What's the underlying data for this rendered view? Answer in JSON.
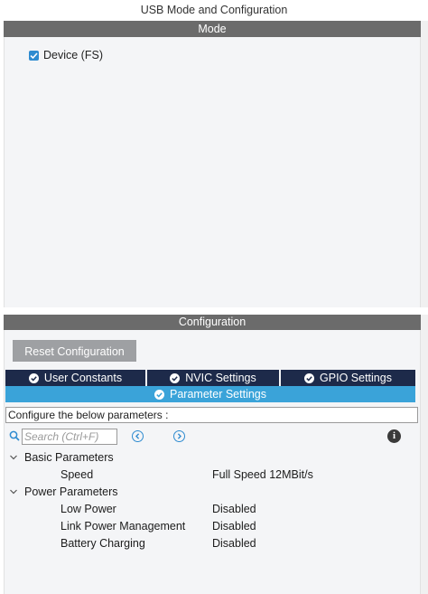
{
  "window": {
    "title": "USB Mode and Configuration"
  },
  "mode": {
    "header": "Mode",
    "device_fs": {
      "label": "Device (FS)",
      "checked": true
    }
  },
  "configuration": {
    "header": "Configuration",
    "reset_button": "Reset Configuration",
    "tabs": [
      {
        "label": "User Constants",
        "icon": "check-circle-icon"
      },
      {
        "label": "NVIC Settings",
        "icon": "check-circle-icon"
      },
      {
        "label": "GPIO Settings",
        "icon": "check-circle-icon"
      },
      {
        "label": "Parameter Settings",
        "icon": "check-circle-icon",
        "active": true
      }
    ],
    "hint": "Configure the below parameters :",
    "search": {
      "placeholder": "Search (Ctrl+F)",
      "value": ""
    },
    "groups": [
      {
        "name": "Basic Parameters",
        "params": [
          {
            "name": "Speed",
            "value": "Full Speed 12MBit/s"
          }
        ]
      },
      {
        "name": "Power Parameters",
        "params": [
          {
            "name": "Low Power",
            "value": "Disabled"
          },
          {
            "name": "Link Power Management",
            "value": "Disabled"
          },
          {
            "name": "Battery Charging",
            "value": "Disabled"
          }
        ]
      }
    ]
  },
  "colors": {
    "header_gray": "#6b6b6b",
    "tab_dark": "#1d2a4a",
    "tab_active": "#3aa3d9",
    "checkbox_blue": "#2e8bd0",
    "reset_gray": "#9ea0a3"
  }
}
